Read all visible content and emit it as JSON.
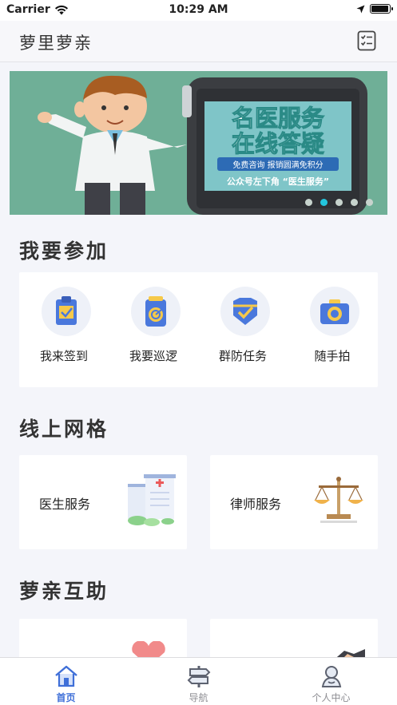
{
  "status_bar": {
    "carrier": "Carrier",
    "time": "10:29 AM",
    "battery_level": 0.95
  },
  "nav": {
    "title": "萝里萝亲",
    "action_icon": "checklist-icon"
  },
  "banner": {
    "line1": "名医服务",
    "line2": "在线答疑",
    "strip": "免费咨询 报销圆满免积分",
    "footer": "公众号左下角 “医生服务”",
    "page_count": 5,
    "active_index": 1
  },
  "sections": {
    "join_title": "我要参加",
    "grid_title": "线上网格",
    "mutual_title": "萝亲互助"
  },
  "join_items": [
    {
      "label": "我来签到",
      "icon": "clipboard-check-icon"
    },
    {
      "label": "我要巡逻",
      "icon": "patrol-radar-icon"
    },
    {
      "label": "群防任务",
      "icon": "shield-check-icon"
    },
    {
      "label": "随手拍",
      "icon": "camera-icon"
    }
  ],
  "grid_items": [
    {
      "label": "医生服务",
      "icon": "hospital-icon"
    },
    {
      "label": "律师服务",
      "icon": "scales-icon"
    }
  ],
  "mutual_items": [
    {
      "icon": "heart-icon"
    },
    {
      "icon": "handshake-icon"
    }
  ],
  "tabs": [
    {
      "label": "首页",
      "icon": "home-icon",
      "active": true
    },
    {
      "label": "导航",
      "icon": "signpost-icon",
      "active": false
    },
    {
      "label": "个人中心",
      "icon": "user-icon",
      "active": false
    }
  ],
  "colors": {
    "accent": "#3f6fd8",
    "banner_bg": "#6faf97",
    "banner_dot_active": "#23c6de",
    "icon_blue": "#4a78dc"
  }
}
